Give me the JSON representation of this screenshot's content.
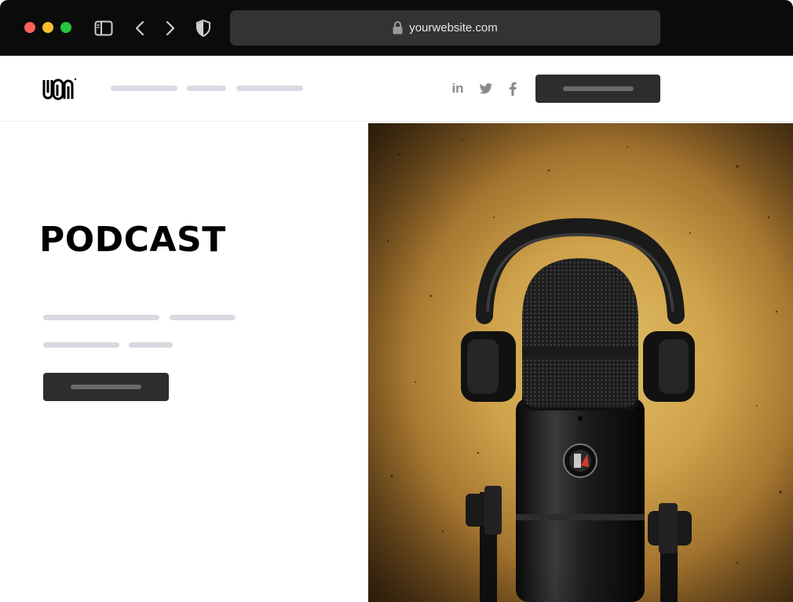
{
  "browser": {
    "url": "yourwebsite.com",
    "icons": [
      "sidebar-icon",
      "back-icon",
      "forward-icon",
      "shield-icon",
      "lock-icon"
    ]
  },
  "header": {
    "logo_text": "LOGO",
    "social": {
      "linkedin": "in"
    },
    "social_icons": [
      "linkedin-icon",
      "twitter-icon",
      "facebook-icon"
    ]
  },
  "hero": {
    "title": "PODCAST"
  },
  "colors": {
    "chrome_bg": "#0b0b0b",
    "url_bar": "#333333",
    "button_dark": "#2d2d2d",
    "placeholder_bar": "#d9d9e1",
    "title": "#000000"
  }
}
